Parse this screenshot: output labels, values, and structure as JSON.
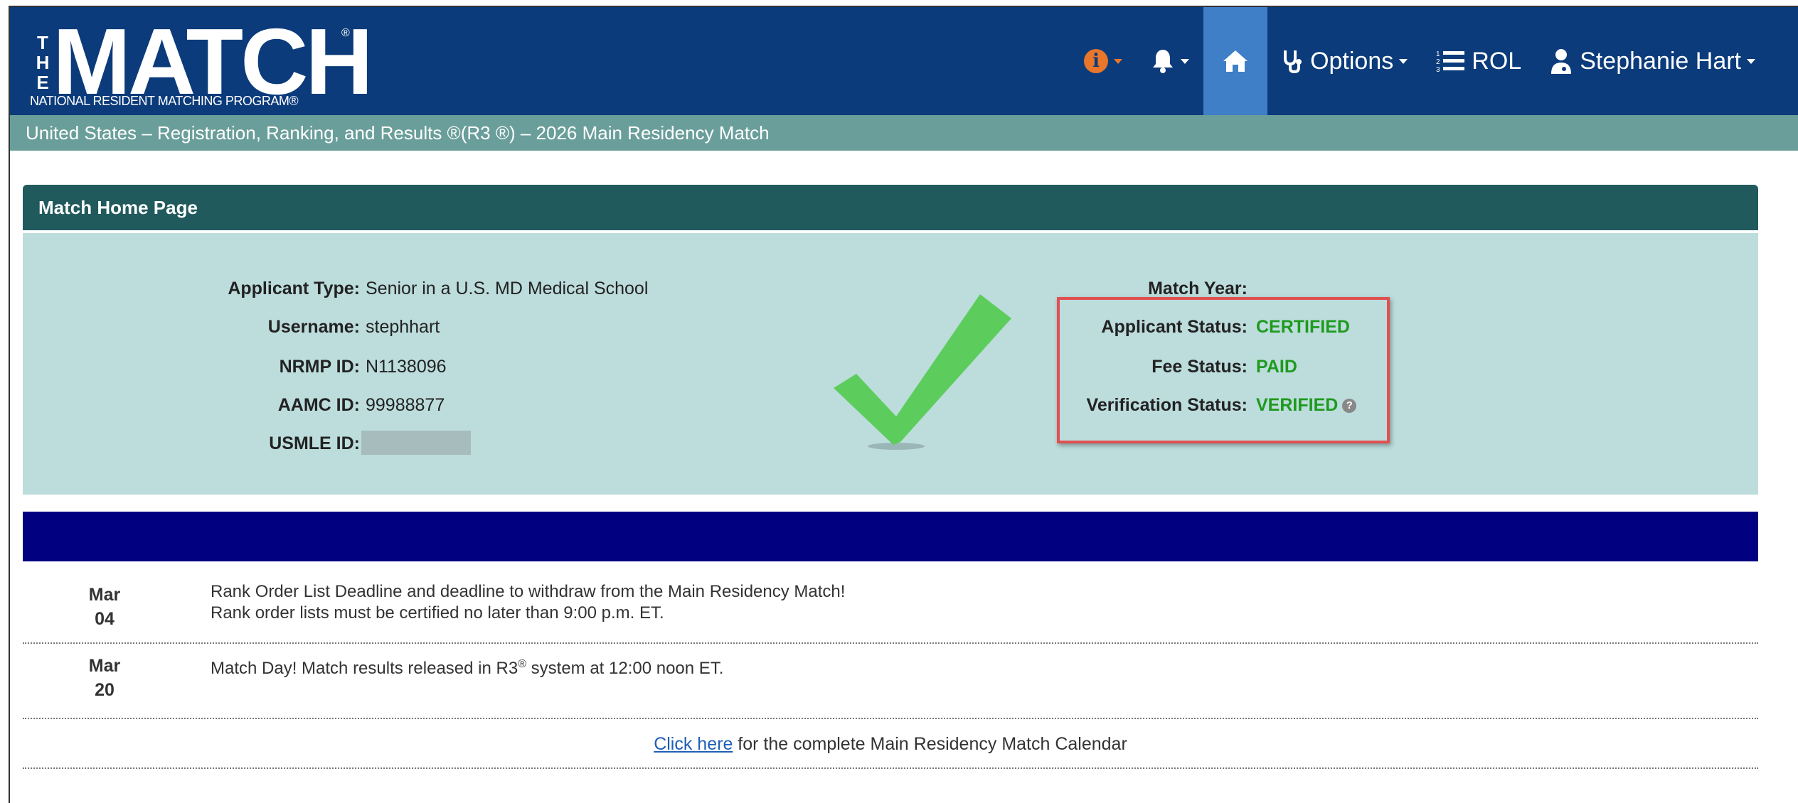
{
  "header": {
    "logo_the": "THE",
    "logo_match": "MATCH",
    "logo_reg": "®",
    "logo_subtitle": "NATIONAL RESIDENT MATCHING PROGRAM®",
    "nav": {
      "options_label": "Options",
      "rol_label": "ROL",
      "user_label": "Stephanie Hart"
    }
  },
  "subheader": {
    "text": "United States  –  Registration, Ranking, and Results ®(R3 ®)  –  2026 Main Residency Match"
  },
  "home_panel": {
    "title": "Match Home Page",
    "left_fields": [
      {
        "label": "Applicant Type:",
        "value": "Senior in a U.S. MD Medical School"
      },
      {
        "label": "Username:",
        "value": "stephhart"
      },
      {
        "label": "NRMP ID:",
        "value": "N1138096"
      },
      {
        "label": "AAMC ID:",
        "value": "99988877"
      },
      {
        "label": "USMLE ID:",
        "value": ""
      }
    ],
    "right_fields": [
      {
        "label": "Match Year:",
        "value": ""
      },
      {
        "label": "Applicant Status:",
        "value": "CERTIFIED"
      },
      {
        "label": "Fee Status:",
        "value": "PAID"
      },
      {
        "label": "Verification Status:",
        "value": "VERIFIED"
      }
    ]
  },
  "calendar": {
    "events": [
      {
        "month": "Mar",
        "day": "04",
        "line1": "Rank Order List Deadline and deadline to withdraw from the Main Residency Match!",
        "line2": "Rank order lists must be certified no later than 9:00 p.m. ET."
      },
      {
        "month": "Mar",
        "day": "20",
        "line1_pre": "Match Day! Match results released in R3",
        "line1_sup": "®",
        "line1_post": " system at 12:00 noon ET."
      }
    ],
    "link_text": "Click here",
    "link_suffix": " for the complete Main Residency Match Calendar"
  },
  "colors": {
    "navbar": "#0b3b7a",
    "nav_active": "#3f7fc8",
    "subbar": "#6a9e9a",
    "panel_head": "#205a5d",
    "panel_body": "#bddcdc",
    "status_green": "#1e9a1e",
    "highlight_red": "#e05050",
    "calendar_bar": "#000080"
  },
  "icons": {
    "info": "info-circle-icon",
    "bell": "bell-icon",
    "home": "home-icon",
    "options": "stethoscope-icon",
    "rol": "ordered-list-icon",
    "user": "user-doctor-icon",
    "checkmark": "checkmark-icon",
    "help": "question-circle-icon"
  }
}
